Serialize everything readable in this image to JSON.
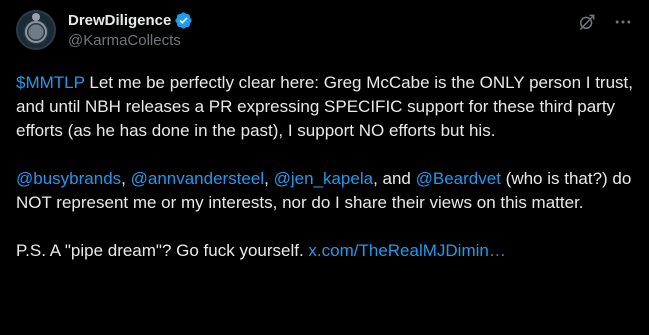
{
  "colors": {
    "background": "#000000",
    "text": "#e7e9ea",
    "secondary_text": "#71767b",
    "link": "#1d9bf0"
  },
  "post": {
    "author": {
      "display_name": "DrewDiligence",
      "handle": "@KarmaCollects",
      "verified_icon": "verified-badge-icon",
      "avatar": "avatar-icon"
    },
    "actions": {
      "grok_icon": "grok-icon",
      "more_icon": "more-icon"
    },
    "p1": {
      "cashtag": "$MMTLP",
      "text": " Let me be perfectly clear here: Greg McCabe is the ONLY person I trust, and until NBH releases a PR expressing SPECIFIC support for these third party efforts (as he has done in the past), I support NO efforts but his."
    },
    "p2": {
      "mention1": "@busybrands",
      "sep1": ", ",
      "mention2": "@annvandersteel",
      "sep2": ", ",
      "mention3": "@jen_kapela",
      "sep3": ", and ",
      "mention4": "@Beardvet",
      "text": " (who is that?) do NOT represent me or my interests, nor do I share their views on this matter."
    },
    "p3": {
      "text": "P.S. A \"pipe dream\"? Go fuck yourself. ",
      "link": "x.com/TheRealMJDimin…"
    }
  }
}
